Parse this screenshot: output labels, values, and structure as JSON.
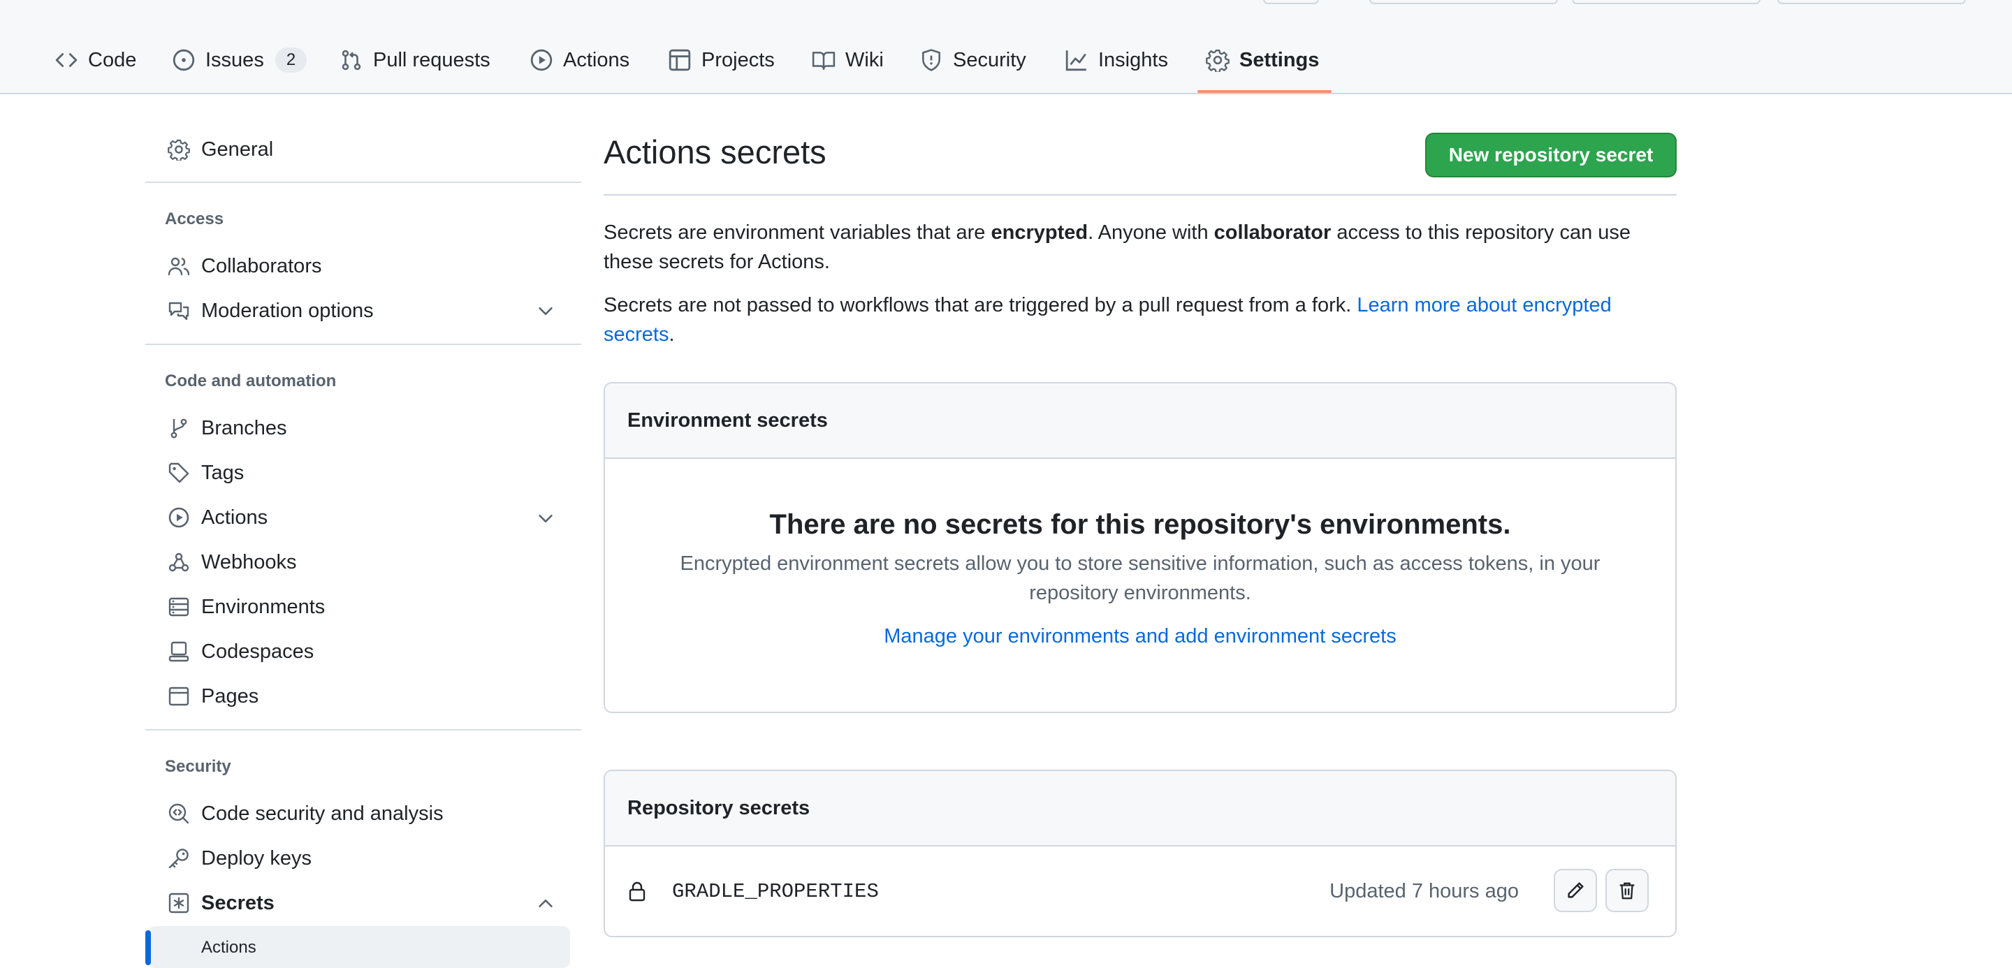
{
  "repo_nav": {
    "tabs": [
      {
        "label": "Code"
      },
      {
        "label": "Issues",
        "count": "2"
      },
      {
        "label": "Pull requests"
      },
      {
        "label": "Actions"
      },
      {
        "label": "Projects"
      },
      {
        "label": "Wiki"
      },
      {
        "label": "Security"
      },
      {
        "label": "Insights"
      },
      {
        "label": "Settings"
      }
    ],
    "selected_tab": "Settings"
  },
  "sidebar": {
    "general": "General",
    "access_heading": "Access",
    "collaborators": "Collaborators",
    "moderation": "Moderation options",
    "code_heading": "Code and automation",
    "branches": "Branches",
    "tags": "Tags",
    "actions": "Actions",
    "webhooks": "Webhooks",
    "environments": "Environments",
    "codespaces": "Codespaces",
    "pages": "Pages",
    "security_heading": "Security",
    "code_security": "Code security and analysis",
    "deploy_keys": "Deploy keys",
    "secrets": "Secrets",
    "secrets_actions": "Actions"
  },
  "main": {
    "title": "Actions secrets",
    "new_secret_button": "New repository secret",
    "intro": {
      "part1": "Secrets are environment variables that are ",
      "bold1": "encrypted",
      "part2": ". Anyone with ",
      "bold2": "collaborator",
      "part3": " access to this repository can use these secrets for Actions."
    },
    "fork_note": {
      "text": "Secrets are not passed to workflows that are triggered by a pull request from a fork. ",
      "link": "Learn more about encrypted secrets",
      "end": "."
    },
    "environment_secrets": {
      "heading": "Environment secrets",
      "empty_title": "There are no secrets for this repository's environments.",
      "empty_desc": "Encrypted environment secrets allow you to store sensitive information, such as access tokens, in your repository environments.",
      "manage_link": "Manage your environments and add environment secrets"
    },
    "repository_secrets": {
      "heading": "Repository secrets",
      "items": [
        {
          "name": "GRADLE_PROPERTIES",
          "updated": "Updated 7 hours ago"
        }
      ]
    }
  },
  "colors": {
    "primary_green": "#2da44e",
    "link_blue": "#0969da",
    "selected_tab_underline": "#fd8c73"
  }
}
